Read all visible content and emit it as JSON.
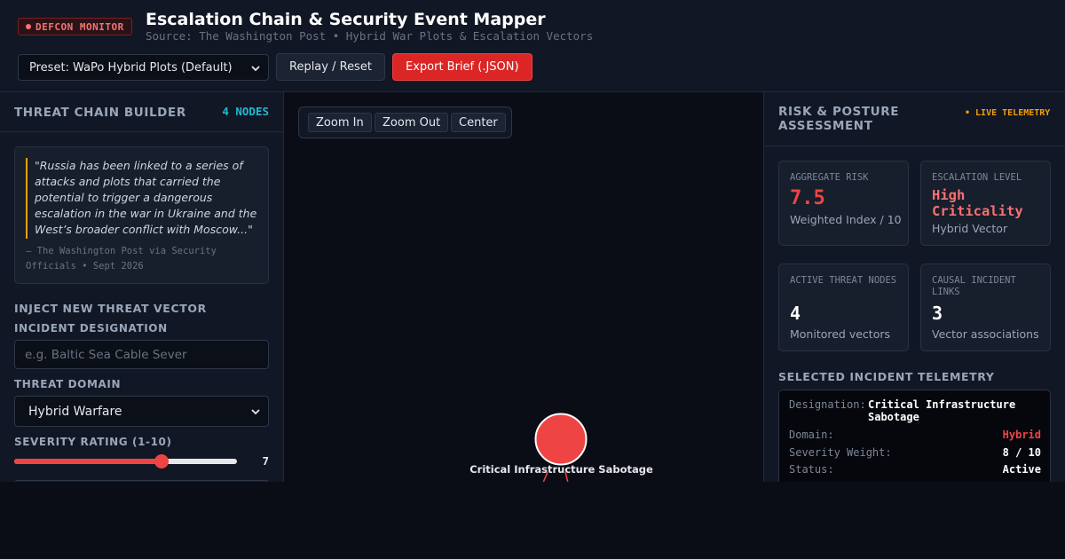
{
  "header": {
    "badge": "DEFCON MONITOR",
    "title": "Escalation Chain & Security Event Mapper",
    "subtitle": "Source: The Washington Post • Hybrid War Plots & Escalation Vectors",
    "preset_value": "Preset: WaPo Hybrid Plots (Default)",
    "replay_label": "Replay / Reset",
    "export_label": "Export Brief (.JSON)"
  },
  "left": {
    "title": "THREAT CHAIN BUILDER",
    "node_count": "4 NODES",
    "quote": "\"Russia has been linked to a series of attacks and plots that carried the potential to trigger a dangerous escalation in the war in Ukraine and the West’s broader conflict with Moscow...\"",
    "quote_source": "— The Washington Post via Security Officials • Sept 2026",
    "inject_title": "INJECT NEW THREAT VECTOR",
    "designation_label": "INCIDENT DESIGNATION",
    "designation_placeholder": "e.g. Baltic Sea Cable Sever",
    "domain_label": "THREAT DOMAIN",
    "domain_value": "Hybrid Warfare",
    "severity_label": "SEVERITY RATING (1-10)",
    "severity_value": "7",
    "severity_level": 0.66
  },
  "canvas": {
    "zoom_in": "Zoom In",
    "zoom_out": "Zoom Out",
    "center": "Center",
    "node_label": "Critical Infrastructure Sabotage",
    "node_color": "#ef4444"
  },
  "right": {
    "title": "RISK & POSTURE ASSESSMENT",
    "live": "• LIVE TELEMETRY",
    "cards": {
      "risk_label": "AGGREGATE RISK",
      "risk_value": "7.5",
      "risk_sub": "Weighted Index / 10",
      "level_label": "ESCALATION LEVEL",
      "level_value": "High Criticality",
      "level_sub": "Hybrid Vector",
      "nodes_label": "ACTIVE THREAT NODES",
      "nodes_value": "4",
      "nodes_sub": "Monitored vectors",
      "links_label": "CAUSAL INCIDENT LINKS",
      "links_value": "3",
      "links_sub": "Vector associations"
    },
    "telemetry_title": "SELECTED INCIDENT TELEMETRY",
    "telemetry": {
      "designation_key": "Designation:",
      "designation_val": "Critical Infrastructure Sabotage",
      "domain_key": "Domain:",
      "domain_val": "Hybrid",
      "severity_key": "Severity Weight:",
      "severity_val": "8 / 10",
      "status_key": "Status:",
      "status_val": "Active"
    }
  },
  "colors": {
    "accent_red": "#ef4444",
    "accent_cyan": "#22b8cf",
    "accent_amber": "#f59e0b"
  }
}
